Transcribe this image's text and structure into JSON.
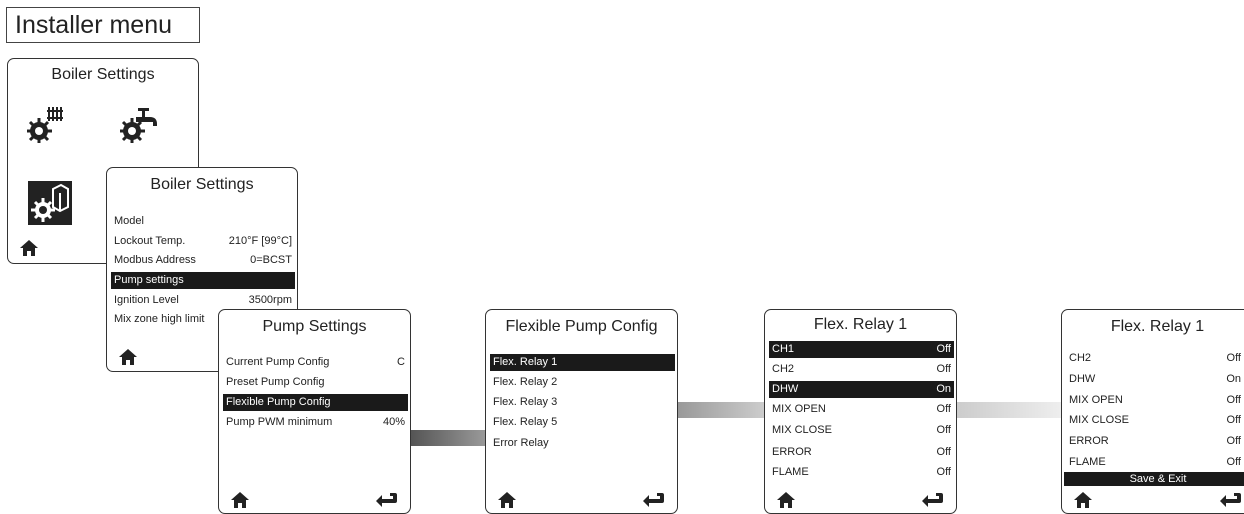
{
  "page": {
    "title": "Installer menu"
  },
  "screen1": {
    "title": "Boiler Settings",
    "icons": [
      "heating-gear-icon",
      "dhw-faucet-gear-icon",
      "boiler-gear-icon"
    ],
    "home_icon": "home-icon"
  },
  "screen2": {
    "title": "Boiler Settings",
    "rows": [
      {
        "label": "Model",
        "value": ""
      },
      {
        "label": "Lockout Temp.",
        "value": "210°F [99°C]"
      },
      {
        "label": "Modbus Address",
        "value": "0=BCST"
      },
      {
        "label": "Pump settings",
        "value": ""
      },
      {
        "label": "Ignition Level",
        "value": "3500rpm"
      },
      {
        "label": "Mix zone high limit",
        "value": ""
      }
    ],
    "selected_index": 3
  },
  "screen3": {
    "title": "Pump Settings",
    "rows": [
      {
        "label": "Current Pump Config",
        "value": "C"
      },
      {
        "label": "Preset Pump Config",
        "value": ""
      },
      {
        "label": "Flexible Pump Config",
        "value": ""
      },
      {
        "label": "Pump PWM minimum",
        "value": "40%"
      }
    ],
    "selected_index": 2
  },
  "screen4": {
    "title": "Flexible Pump Config",
    "rows": [
      {
        "label": "Flex. Relay 1"
      },
      {
        "label": "Flex. Relay 2"
      },
      {
        "label": "Flex. Relay 3"
      },
      {
        "label": "Flex. Relay 5"
      },
      {
        "label": "Error Relay"
      }
    ],
    "selected_index": 0
  },
  "screen5": {
    "title": "Flex. Relay 1",
    "rows": [
      {
        "label": "CH1",
        "value": "Off",
        "selected": true
      },
      {
        "label": "CH2",
        "value": "Off",
        "selected": false
      },
      {
        "label": "DHW",
        "value": "On",
        "selected": true
      },
      {
        "label": "MIX OPEN",
        "value": "Off",
        "selected": false
      },
      {
        "label": "MIX CLOSE",
        "value": "Off",
        "selected": false
      },
      {
        "label": "ERROR",
        "value": "Off",
        "selected": false
      },
      {
        "label": "FLAME",
        "value": "Off",
        "selected": false
      }
    ]
  },
  "screen6": {
    "title": "Flex. Relay 1",
    "rows": [
      {
        "label": "CH2",
        "value": "Off"
      },
      {
        "label": "DHW",
        "value": "On"
      },
      {
        "label": "MIX OPEN",
        "value": "Off"
      },
      {
        "label": "MIX CLOSE",
        "value": "Off"
      },
      {
        "label": "ERROR",
        "value": "Off"
      },
      {
        "label": "FLAME",
        "value": "Off"
      }
    ],
    "save_label": "Save & Exit"
  }
}
